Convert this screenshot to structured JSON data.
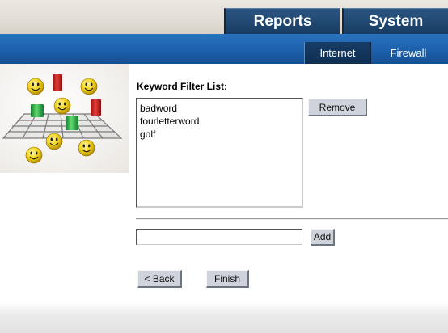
{
  "header": {
    "tabs": [
      {
        "label": "Reports"
      },
      {
        "label": "System"
      }
    ]
  },
  "subnav": {
    "tabs": [
      {
        "label": "Internet",
        "active": true
      },
      {
        "label": "Firewall",
        "active": false
      }
    ]
  },
  "illustration": {
    "icon": "smiley-faces-grid-illustration",
    "colors": {
      "smiley": "#f2d31c",
      "red_block": "#d0221f",
      "green_block": "#2fb34a",
      "grid": "#7a7a7a"
    }
  },
  "filter": {
    "title": "Keyword Filter List:",
    "keywords": [
      "badword",
      "fourletterword",
      "golf"
    ],
    "remove_label": "Remove",
    "input_value": "",
    "add_label": "Add"
  },
  "nav_buttons": {
    "back_label": "< Back",
    "finish_label": "Finish"
  },
  "colors": {
    "header_tab": "#1f4a75",
    "subnav_bar": "#1f63ad",
    "subnav_active": "#133760",
    "button_face": "#cfd4dc"
  }
}
